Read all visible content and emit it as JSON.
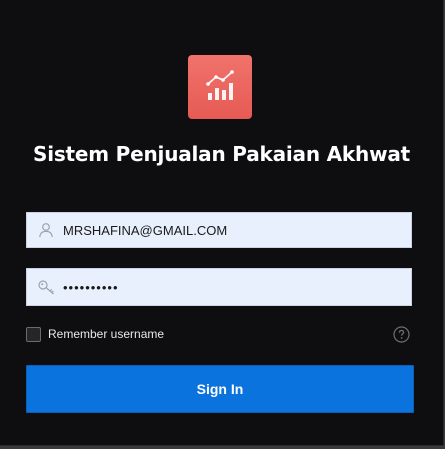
{
  "app": {
    "title": "Sistem Penjualan Pakaian Akhwat",
    "logo_icon": "chart-trend-icon",
    "logo_color": "#ea625c"
  },
  "login": {
    "username": {
      "value": "MRSHAFINA@GMAIL.COM",
      "icon": "user-icon"
    },
    "password": {
      "value": "••••••••••",
      "icon": "key-icon"
    },
    "remember_label": "Remember username",
    "remember_checked": false,
    "help_icon": "help-icon",
    "signin_label": "Sign In",
    "signin_color": "#0b73de"
  }
}
